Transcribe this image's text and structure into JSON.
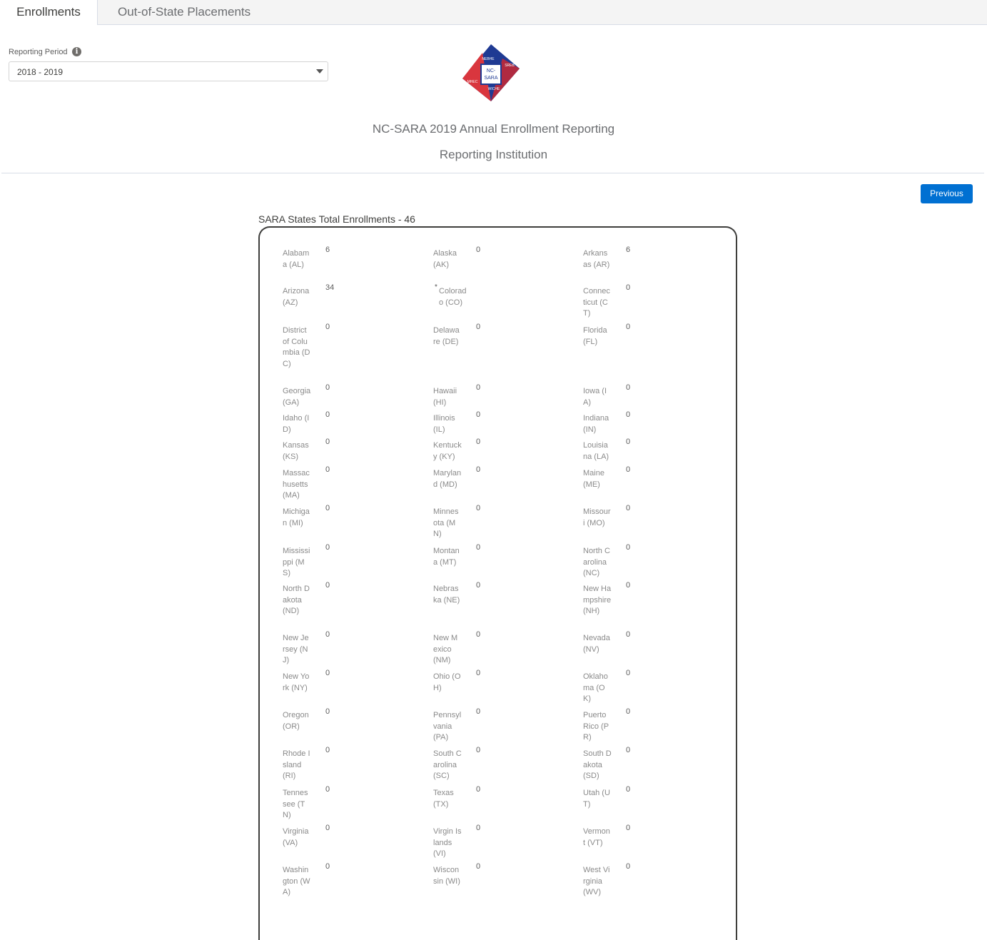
{
  "tabs": [
    {
      "label": "Enrollments",
      "active": true
    },
    {
      "label": "Out-of-State Placements",
      "active": false
    }
  ],
  "filter": {
    "label": "Reporting Period",
    "info_icon": "info-icon",
    "selected": "2018 - 2019"
  },
  "logo": {
    "center_text_line1": "NC-",
    "center_text_line2": "SARA",
    "corner_labels": [
      "NEBHE",
      "SREB",
      "MHEC",
      "WICHE"
    ],
    "colors": {
      "blue": "#1f3a93",
      "red": "#d9363e"
    }
  },
  "header": {
    "title": "NC-SARA 2019 Annual Enrollment Reporting",
    "subtitle": "Reporting Institution"
  },
  "actions": {
    "previous_label": "Previous"
  },
  "summary": {
    "label": "SARA States Total Enrollments - 46"
  },
  "colors": {
    "accent": "#0070d2",
    "panel_border": "#3e3e3c"
  },
  "states": [
    {
      "name": "Alabama (AL)",
      "value": "6"
    },
    {
      "name": "Alaska (AK)",
      "value": "0"
    },
    {
      "name": "Arkansas (AR)",
      "value": "6"
    },
    {
      "name": "Arizona (AZ)",
      "value": "34"
    },
    {
      "name": "Colorado (CO)",
      "value": "",
      "required": true
    },
    {
      "name": "Connecticut (CT)",
      "value": "0"
    },
    {
      "name": "District of Columbia (DC)",
      "value": "0"
    },
    {
      "name": "Delaware (DE)",
      "value": "0"
    },
    {
      "name": "Florida (FL)",
      "value": "0"
    },
    {
      "name": "Georgia (GA)",
      "value": "0"
    },
    {
      "name": "Hawaii (HI)",
      "value": "0"
    },
    {
      "name": "Iowa (IA)",
      "value": "0"
    },
    {
      "name": "Idaho (ID)",
      "value": "0"
    },
    {
      "name": "Illinois (IL)",
      "value": "0"
    },
    {
      "name": "Indiana (IN)",
      "value": "0"
    },
    {
      "name": "Kansas (KS)",
      "value": "0"
    },
    {
      "name": "Kentucky (KY)",
      "value": "0"
    },
    {
      "name": "Louisiana (LA)",
      "value": "0"
    },
    {
      "name": "Massachusetts (MA)",
      "value": "0"
    },
    {
      "name": "Maryland (MD)",
      "value": "0"
    },
    {
      "name": "Maine (ME)",
      "value": "0"
    },
    {
      "name": "Michigan (MI)",
      "value": "0"
    },
    {
      "name": "Minnesota (MN)",
      "value": "0"
    },
    {
      "name": "Missouri (MO)",
      "value": "0"
    },
    {
      "name": "Mississippi (MS)",
      "value": "0"
    },
    {
      "name": "Montana (MT)",
      "value": "0"
    },
    {
      "name": "North Carolina (NC)",
      "value": "0"
    },
    {
      "name": "North Dakota (ND)",
      "value": "0"
    },
    {
      "name": "Nebraska (NE)",
      "value": "0"
    },
    {
      "name": "New Hampshire (NH)",
      "value": "0"
    },
    {
      "name": "New Jersey (NJ)",
      "value": "0"
    },
    {
      "name": "New Mexico (NM)",
      "value": "0"
    },
    {
      "name": "Nevada (NV)",
      "value": "0"
    },
    {
      "name": "New York (NY)",
      "value": "0"
    },
    {
      "name": "Ohio (OH)",
      "value": "0"
    },
    {
      "name": "Oklahoma (OK)",
      "value": "0"
    },
    {
      "name": "Oregon (OR)",
      "value": "0"
    },
    {
      "name": "Pennsylvania (PA)",
      "value": "0"
    },
    {
      "name": "Puerto Rico (PR)",
      "value": "0"
    },
    {
      "name": "Rhode Island (RI)",
      "value": "0"
    },
    {
      "name": "South Carolina (SC)",
      "value": "0"
    },
    {
      "name": "South Dakota (SD)",
      "value": "0"
    },
    {
      "name": "Tennessee (TN)",
      "value": "0"
    },
    {
      "name": "Texas (TX)",
      "value": "0"
    },
    {
      "name": "Utah (UT)",
      "value": "0"
    },
    {
      "name": "Virginia (VA)",
      "value": "0"
    },
    {
      "name": "Virgin Islands (VI)",
      "value": "0"
    },
    {
      "name": "Vermont (VT)",
      "value": "0"
    },
    {
      "name": "Washington (WA)",
      "value": "0"
    },
    {
      "name": "Wisconsin (WI)",
      "value": "0"
    },
    {
      "name": "West Virginia (WV)",
      "value": "0"
    }
  ]
}
